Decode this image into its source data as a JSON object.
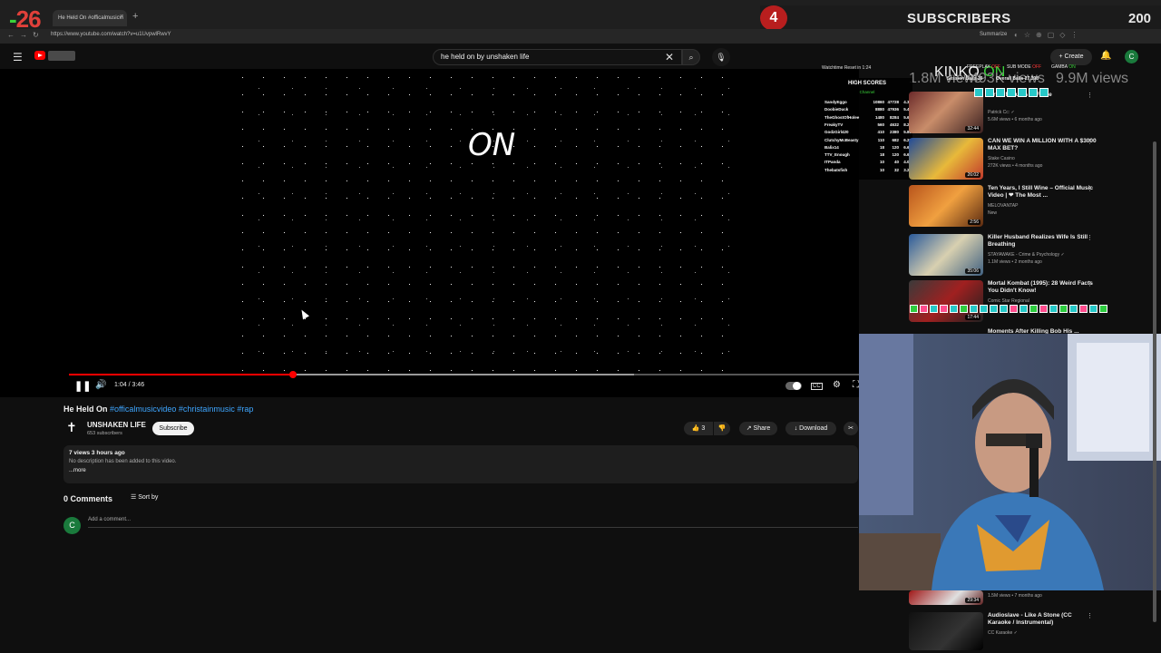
{
  "browser": {
    "tab_title": "He Held On #officalmusicvi",
    "tab_close": "×",
    "new_tab": "+",
    "url": "https://www.youtube.com/watch?v=u1UvpwlRwvY",
    "summarize": "Summarize"
  },
  "stream_overlay": {
    "left_counter_green": "-",
    "left_counter": "26",
    "sub_count": "4",
    "sub_label": "SUBSCRIBERS",
    "sub_target": "200"
  },
  "header": {
    "menu_icon": "☰",
    "search_value": "he held on by unshaken life",
    "clear_icon": "✕",
    "search_icon": "⌕",
    "mic_icon": "🎙",
    "create_label": "+ Create",
    "bell_icon": "🔔",
    "avatar_letter": "C"
  },
  "player": {
    "on_screen_text": "ON",
    "pause_icon": "❚❚",
    "volume_icon": "🔊",
    "time_display": "1:04 / 3:46",
    "progress_fraction": 0.2832,
    "buffered_fraction": 0.714,
    "cc_icon": "CC",
    "settings_icon": "⚙",
    "fullscreen_icon": "⛶"
  },
  "video": {
    "title": "He Held On ",
    "hashtags": "#officalmusicvideo #christainmusic #rap",
    "channel_icon": "✝",
    "channel_name": "UNSHAKEN LIFE",
    "channel_subs": "653 subscribers",
    "subscribe_label": "Subscribe",
    "like_label": "👍 3",
    "dislike_icon": "👎",
    "share_label": "↗ Share",
    "download_label": "↓ Download",
    "clip_icon": "✂",
    "views_time": "7 views  3 hours ago",
    "description": "No description has been added to this video.",
    "more_label": "...more"
  },
  "comments": {
    "count_label": "0 Comments",
    "sort_label": "☰  Sort by",
    "avatar_letter": "C",
    "placeholder": "Add a comment..."
  },
  "sidebar": {
    "watchtime": "Watchtime Reset in 1:24",
    "stats": [
      {
        "label": "KINKO",
        "state": "ON",
        "state_class": "on"
      },
      {
        "label": "FREEPLAY",
        "state": "OFF",
        "state_class": "off"
      },
      {
        "label": "SUB MODE",
        "state": "OFF",
        "state_class": "off"
      },
      {
        "label": "GAMBA",
        "state": "ON",
        "state_class": "on"
      }
    ],
    "session_balls_label": "Session Balls",
    "session_balls_value": "30",
    "overall_balls_label": "Overall Balls",
    "overall_balls_value": "27,398",
    "view_counts": [
      "1.8M views",
      "493K views",
      "9.9M views"
    ],
    "high_scores": {
      "title": "HIGH SCORES",
      "subtitle": "Channel",
      "rows": [
        {
          "name": "SandyEggo",
          "a": "10860",
          "b": "47728",
          "c": "4.39"
        },
        {
          "name": "DoobieDuck",
          "a": "8880",
          "b": "47936",
          "c": "5.40"
        },
        {
          "name": "TheGhostOfHolee",
          "a": "1480",
          "b": "8284",
          "c": "5.60"
        },
        {
          "name": "FreakyTV",
          "a": "560",
          "b": "4632",
          "c": "8.27"
        },
        {
          "name": "GodzGirl420",
          "a": "410",
          "b": "2380",
          "c": "5.80"
        },
        {
          "name": "ClutchyMcBeasty",
          "a": "110",
          "b": "682",
          "c": "6.20"
        },
        {
          "name": "Balix14",
          "a": "18",
          "b": "120",
          "c": "6.67"
        },
        {
          "name": "TTV_Enough",
          "a": "18",
          "b": "120",
          "c": "6.67"
        },
        {
          "name": "ITPanda",
          "a": "10",
          "b": "40",
          "c": "4.00"
        },
        {
          "name": "Thebatsfish",
          "a": "10",
          "b": "32",
          "c": "3.20"
        }
      ]
    },
    "recommendations": [
      {
        "title": "for 15 Minutes of Fame",
        "meta1": "Patrick Cc: ✓",
        "meta2": "5.6M views • 6 months ago",
        "duration": "32:44",
        "thumb": "linear-gradient(135deg,#6b2a2a,#c98d6a 45%,#3a1f1f)"
      },
      {
        "title": "CAN WE WIN A MILLION WITH A $3000 MAX BET?",
        "meta1": "Stake Casino",
        "meta2": "272K views • 4 months ago",
        "duration": "26:02",
        "thumb": "linear-gradient(135deg,#1e4a9a,#e8b93a 55%,#c0392b)"
      },
      {
        "title": "Ten Years, I Still Wine – Official Music Video | ❤ The Most ...",
        "meta1": "MELOVANTAP",
        "meta2": "New",
        "duration": "2:56",
        "thumb": "linear-gradient(135deg,#b8541c,#f0a040 50%,#5a2a10)"
      },
      {
        "title": "Killer Husband Realizes Wife Is Still Breathing",
        "meta1": "STAYAWAKE - Crime & Psychology ✓",
        "meta2": "1.1M views • 2 months ago",
        "duration": "35:06",
        "thumb": "linear-gradient(135deg,#2a5a9a,#d8d0b0 50%,#406080)"
      },
      {
        "title": "Mortal Kombat (1995): 28 Weird Facts You Didn't Know!",
        "meta1": "Comic Star Regional",
        "meta2": "",
        "duration": "17:44",
        "thumb": "linear-gradient(135deg,#3a3a3a,#a02020 50%,#202020)"
      }
    ],
    "rec_partial_title": "Moments After Killing Bob His ...",
    "bottom_recs": [
      {
        "title": "",
        "meta": "1.5M views • 7 months ago",
        "duration": "29:34",
        "thumb": "linear-gradient(135deg,#a01818,#e0e0e0 60%,#602020)"
      },
      {
        "title": "Audioslave - Like A Stone (CC Karaoke / Instrumental)",
        "meta": "CC Karaoke ✓",
        "duration": "",
        "thumb": "linear-gradient(135deg,#111,#333 60%,#000)"
      }
    ],
    "menu_dots": "⋮"
  },
  "colors": {
    "accent_red": "#ff0000",
    "link_blue": "#3ea6ff",
    "avatar_green": "#1a7a3c"
  }
}
